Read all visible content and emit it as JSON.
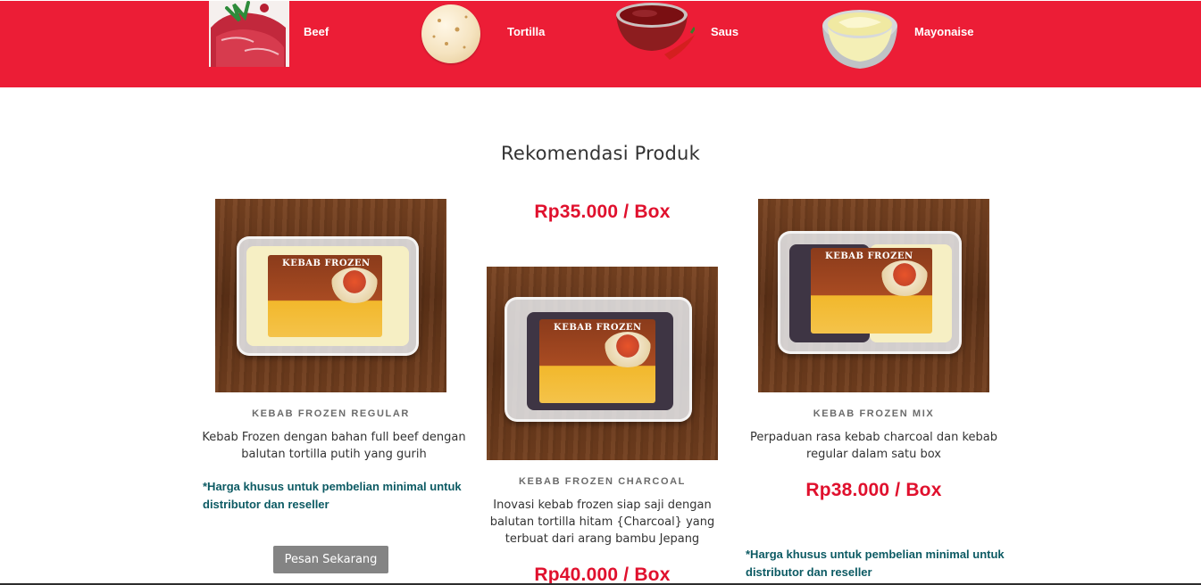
{
  "banner": {
    "items": [
      {
        "label": "Beef",
        "icon": "beef-icon"
      },
      {
        "label": "Tortilla",
        "icon": "tortilla-icon"
      },
      {
        "label": "Saus",
        "icon": "sauce-icon"
      },
      {
        "label": "Mayonaise",
        "icon": "mayonnaise-icon"
      }
    ],
    "background_color": "#ec1d36"
  },
  "section": {
    "title": "Rekomendasi Produk"
  },
  "products": [
    {
      "name": "KEBAB FROZEN REGULAR",
      "description": "Kebab Frozen dengan bahan full beef dengan balutan tortilla putih yang gurih",
      "note": "*Harga khusus untuk pembelian minimal untuk distributor dan reseller",
      "button_label": "Pesan Sekarang",
      "package_label": "KEBAB FROZEN"
    },
    {
      "name": "KEBAB FROZEN CHARCOAL",
      "description": "Inovasi kebab frozen siap saji dengan balutan tortilla hitam {Charcoal} yang terbuat dari arang bambu Jepang",
      "price_top": "Rp35.000 / Box",
      "price": "Rp40.000 / Box",
      "package_label": "KEBAB FROZEN"
    },
    {
      "name": "KEBAB FROZEN MIX",
      "description": "Perpaduan rasa kebab charcoal dan kebab regular dalam satu box",
      "price": "Rp38.000 / Box",
      "note": "*Harga khusus untuk pembelian minimal untuk distributor dan reseller",
      "package_label": "KEBAB FROZEN"
    }
  ],
  "colors": {
    "price": "#e0102d",
    "note": "#0c5a63",
    "button": "#848484"
  }
}
